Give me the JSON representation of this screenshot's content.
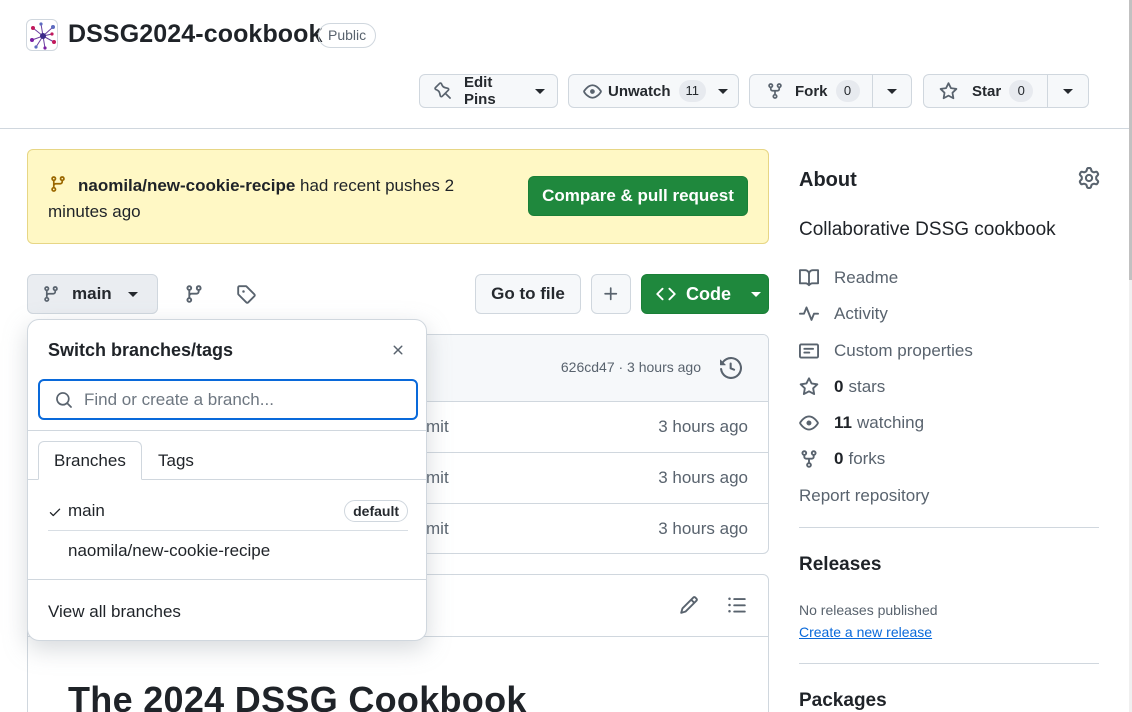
{
  "repo": {
    "name": "DSSG2024-cookbook",
    "visibility": "Public"
  },
  "header_actions": {
    "edit_pins": "Edit Pins",
    "unwatch": "Unwatch",
    "unwatch_count": "11",
    "fork": "Fork",
    "fork_count": "0",
    "star": "Star",
    "star_count": "0"
  },
  "banner": {
    "branch": "naomila/new-cookie-recipe",
    "message": " had recent pushes 2 minutes ago",
    "compare_button": "Compare & pull request"
  },
  "toolbar": {
    "branch_name": "main",
    "go_to_file": "Go to file",
    "code_button": "Code"
  },
  "latest_commit": {
    "meta": "626cd47 · 3 hours ago"
  },
  "file_rows": [
    {
      "message": "mit",
      "time": "3 hours ago"
    },
    {
      "message": "mit",
      "time": "3 hours ago"
    },
    {
      "message": "mit",
      "time": "3 hours ago"
    }
  ],
  "readme": {
    "heading": "The 2024 DSSG Cookbook"
  },
  "branch_dropdown": {
    "title": "Switch branches/tags",
    "search_placeholder": "Find or create a branch...",
    "tabs": [
      "Branches",
      "Tags"
    ],
    "branches": [
      {
        "name": "main",
        "selected": true,
        "badge": "default"
      },
      {
        "name": "naomila/new-cookie-recipe",
        "selected": false
      }
    ],
    "view_all": "View all branches"
  },
  "about": {
    "title": "About",
    "description": "Collaborative DSSG cookbook",
    "links": {
      "readme": "Readme",
      "activity": "Activity",
      "custom_properties": "Custom properties",
      "stars_count": "0",
      "stars_label": "stars",
      "watching_count": "11",
      "watching_label": "watching",
      "forks_count": "0",
      "forks_label": "forks",
      "report": "Report repository"
    }
  },
  "releases": {
    "title": "Releases",
    "none_text": "No releases published",
    "create_link": "Create a new release"
  },
  "packages": {
    "title": "Packages"
  },
  "colors": {
    "primary_green": "#1f883d",
    "link_blue": "#0969da",
    "banner_yellow": "#fff8c5",
    "border": "#d0d7de"
  },
  "icons": [
    "repo-avatar-icon",
    "pin-icon",
    "eye-icon",
    "fork-icon",
    "star-icon",
    "git-branch-icon",
    "tag-icon",
    "plus-icon",
    "code-icon",
    "history-icon",
    "pencil-icon",
    "list-icon",
    "close-icon",
    "search-icon",
    "check-icon",
    "gear-icon",
    "book-icon",
    "pulse-icon",
    "note-icon"
  ]
}
